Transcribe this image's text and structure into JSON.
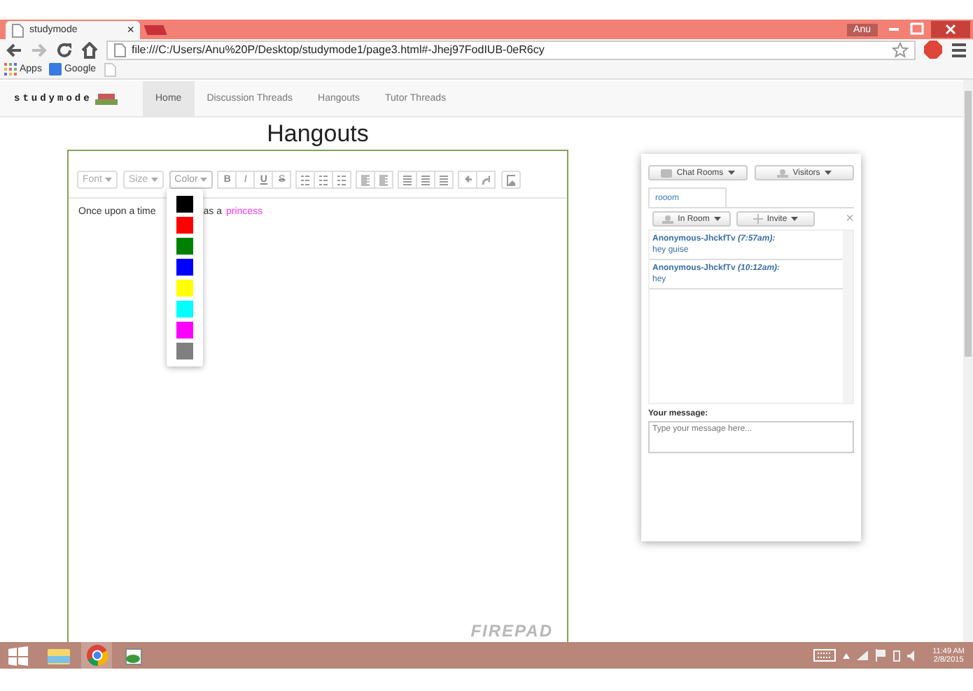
{
  "browser": {
    "tab_title": "studymode",
    "tab_close": "×",
    "user": "Anu",
    "address": "file:///C:/Users/Anu%20P/Desktop/studymode1/page3.html#-Jhej97FodIUB-0eR6cy",
    "bookmarks": [
      "Apps",
      "Google"
    ]
  },
  "site": {
    "logo": "studymode",
    "nav": [
      {
        "label": "Home",
        "selected": true
      },
      {
        "label": "Discussion Threads",
        "selected": false
      },
      {
        "label": "Hangouts",
        "selected": false
      },
      {
        "label": "Tutor Threads",
        "selected": false
      }
    ]
  },
  "page_title": "Hangouts",
  "editor": {
    "dropdowns": [
      {
        "label": "Font",
        "expanded": false
      },
      {
        "label": "Size",
        "expanded": false
      },
      {
        "label": "Color",
        "expanded": true
      }
    ],
    "format_buttons": [
      "B",
      "I",
      "U",
      "S"
    ],
    "text_runs": [
      {
        "text": "Once upon a time",
        "color": "#333333"
      },
      {
        "text": "as a",
        "color": "#333333"
      },
      {
        "text": "princess",
        "color": "#ff33ff"
      }
    ],
    "swatches": [
      {
        "color": "#000000"
      },
      {
        "color": "#ff0000"
      },
      {
        "color": "#008000"
      },
      {
        "color": "#0000ff"
      },
      {
        "color": "#ffff00"
      },
      {
        "color": "#00ffff"
      },
      {
        "color": "#ff00ff"
      },
      {
        "color": "#808080"
      }
    ],
    "watermark": "FIREPAD"
  },
  "chat": {
    "top_buttons": [
      "Chat Rooms",
      "Visitors"
    ],
    "room_tab": "rooom",
    "room_buttons": [
      "In Room",
      "Invite"
    ],
    "close": "×",
    "messages": [
      {
        "author": "Anonymous-JhckfTv",
        "time": "(7:57am):",
        "text": "hey guise"
      },
      {
        "author": "Anonymous-JhckfTv",
        "time": "(10:12am):",
        "text": "hey"
      }
    ],
    "message_label": "Your message:",
    "message_placeholder": "Type your message here..."
  },
  "taskbar": {
    "apps": [
      {
        "kind": "explorer",
        "selected": false
      },
      {
        "kind": "chrome",
        "selected": true
      },
      {
        "kind": "paint",
        "selected": false
      }
    ],
    "time": "11:49 AM",
    "date": "2/8/2015"
  }
}
